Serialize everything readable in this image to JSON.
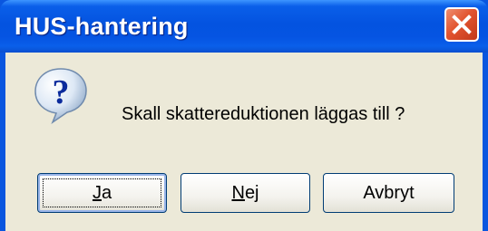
{
  "dialog": {
    "title": "HUS-hantering",
    "icon": "question-icon",
    "message": "Skall skattereduktionen läggas till ?"
  },
  "buttons": [
    {
      "label_mnemonic": "J",
      "label_rest": "a",
      "default": true
    },
    {
      "label_mnemonic": "N",
      "label_rest": "ej",
      "default": false
    },
    {
      "label": "Avbryt",
      "default": false
    }
  ],
  "colors": {
    "titlebar": "#0453e0",
    "close_button": "#e2542f",
    "client_background": "#ece9d8"
  }
}
